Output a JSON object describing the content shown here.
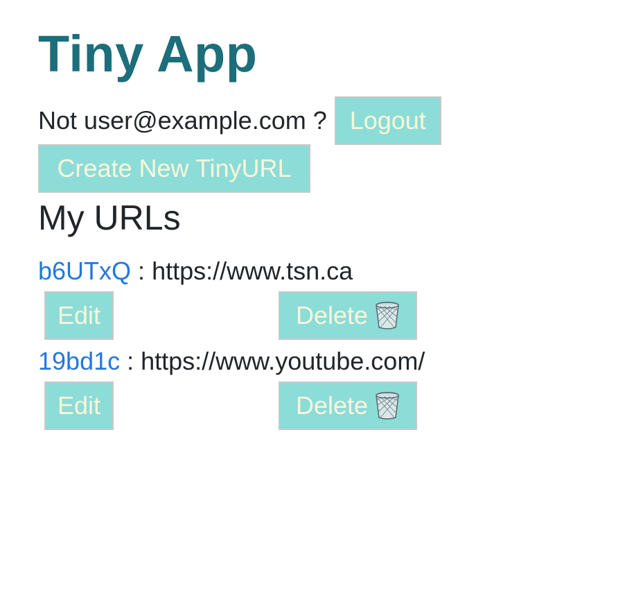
{
  "app": {
    "title": "Tiny App"
  },
  "header": {
    "not_label": "Not",
    "user_email": "user@example.com",
    "question_mark": "?",
    "logout_label": "Logout"
  },
  "actions": {
    "create_label": "Create New TinyURL"
  },
  "urls_section": {
    "title": "My URLs",
    "separator": ":",
    "edit_label": "Edit",
    "delete_label": "Delete",
    "delete_icon": "trash-can-icon",
    "items": [
      {
        "short_id": "b6UTxQ",
        "long_url": "https://www.tsn.ca"
      },
      {
        "short_id": "19bd1c",
        "long_url": "https://www.youtube.com/"
      }
    ]
  },
  "colors": {
    "title": "#1c6e7a",
    "button_bg": "#8cdcd8",
    "button_text": "#fbf6da",
    "link": "#2277e0",
    "body_text": "#212529"
  }
}
